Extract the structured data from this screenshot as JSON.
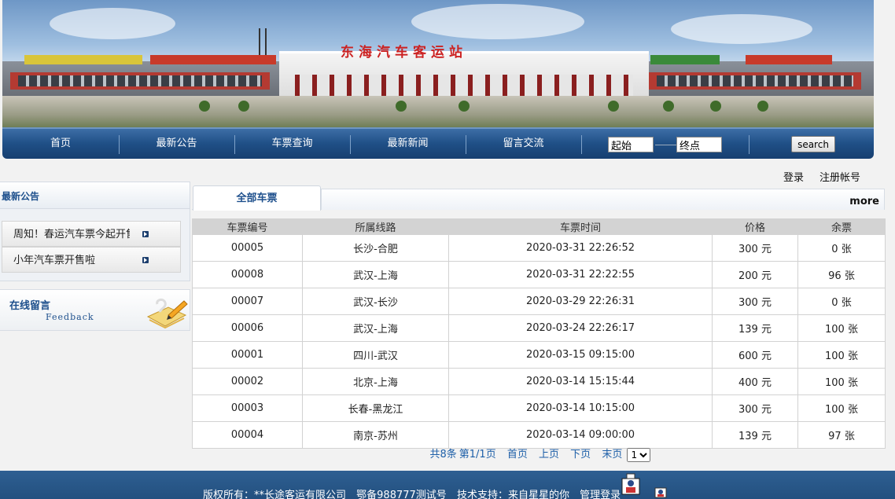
{
  "banner": {
    "title": "东海汽车客运站"
  },
  "nav": {
    "items": [
      "首页",
      "最新公告",
      "车票查询",
      "最新新闻",
      "留言交流"
    ],
    "start_value": "起始",
    "end_value": "终点",
    "search_label": "search"
  },
  "auth": {
    "login": "登录",
    "register": "注册帐号"
  },
  "sidebar": {
    "notice_title": "最新公告",
    "notices": [
      "周知！春运汽车票今起开售",
      "小年汽车票开售啦"
    ],
    "feedback_title": "在线留言",
    "feedback_sub": "Feedback"
  },
  "main": {
    "tab_label": "全部车票",
    "more_label": "more",
    "columns": [
      "车票编号",
      "所属线路",
      "车票时间",
      "价格",
      "余票"
    ],
    "rows": [
      [
        "00005",
        "长沙-合肥",
        "2020-03-31 22:26:52",
        "300 元",
        "0 张"
      ],
      [
        "00008",
        "武汉-上海",
        "2020-03-31 22:22:55",
        "200 元",
        "96 张"
      ],
      [
        "00007",
        "武汉-长沙",
        "2020-03-29 22:26:31",
        "300 元",
        "0 张"
      ],
      [
        "00006",
        "武汉-上海",
        "2020-03-24 22:26:17",
        "139 元",
        "100 张"
      ],
      [
        "00001",
        "四川-武汉",
        "2020-03-15 09:15:00",
        "600 元",
        "100 张"
      ],
      [
        "00002",
        "北京-上海",
        "2020-03-14 15:15:44",
        "400 元",
        "100 张"
      ],
      [
        "00003",
        "长春-黑龙江",
        "2020-03-14 10:15:00",
        "300 元",
        "100 张"
      ],
      [
        "00004",
        "南京-苏州",
        "2020-03-14 09:00:00",
        "139 元",
        "97 张"
      ]
    ],
    "pager": {
      "total": "共8条",
      "page": "第1/1页",
      "first": "首页",
      "prev": "上页",
      "next": "下页",
      "last": "末页",
      "select_value": "1"
    }
  },
  "footer": {
    "copyright": "版权所有：**长途客运有限公司",
    "icp": "鄂备988777测试号",
    "support": "技术支持：来自星星的你",
    "admin_login": "管理登录"
  },
  "colors": {
    "nav": "#1f4f86",
    "link": "#1d5fa8",
    "footer": "#2e5f92",
    "accent_red": "#c22"
  }
}
